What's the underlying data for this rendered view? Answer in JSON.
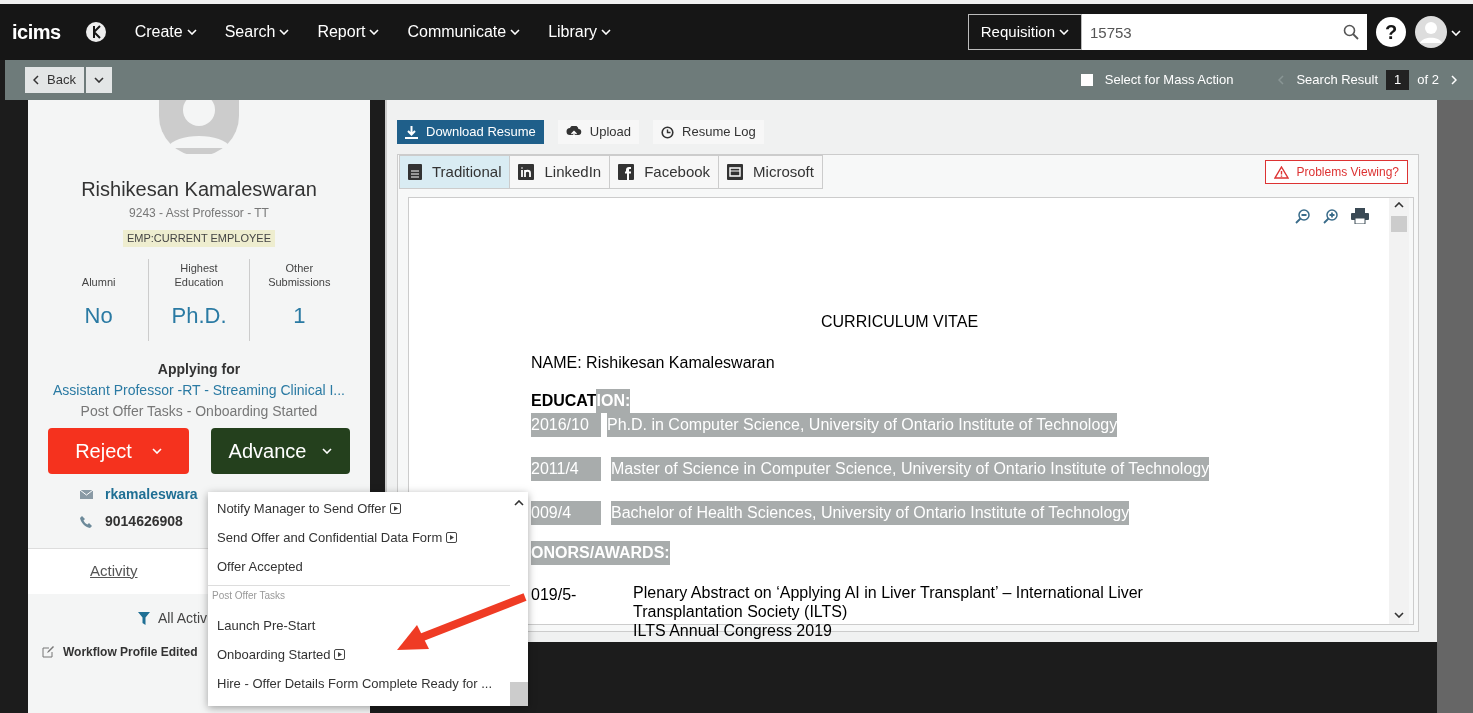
{
  "nav": {
    "logo": "icims",
    "menus": [
      "Create",
      "Search",
      "Report",
      "Communicate",
      "Library"
    ],
    "search_type": "Requisition",
    "search_value": "15753",
    "help": "?"
  },
  "toolbar": {
    "back": "Back",
    "mass_action": {
      "label": "Select for Mass Action",
      "checked": false
    },
    "search_result": {
      "label": "Search Result",
      "page": "1",
      "of": "of 2"
    }
  },
  "profile": {
    "name": "Rishikesan Kamaleswaran",
    "subtitle": "9243 - Asst Professor - TT",
    "badge": "EMP:CURRENT EMPLOYEE",
    "stats": [
      {
        "label": "Alumni",
        "value": "No"
      },
      {
        "label": "Highest Education",
        "value": "Ph.D."
      },
      {
        "label": "Other Submissions",
        "value": "1"
      }
    ],
    "applying_label": "Applying for",
    "job": "Assistant Professor -RT - Streaming Clinical I...",
    "status": "Post Offer Tasks - Onboarding Started",
    "reject": "Reject",
    "advance": "Advance",
    "email": "rkamaleswara",
    "phone": "9014626908",
    "tab": "Activity",
    "filter": "All Activ",
    "activity": "Workflow Profile Edited"
  },
  "resume": {
    "actions": [
      {
        "label": "Download Resume",
        "kind": "primary"
      },
      {
        "label": "Upload",
        "kind": "upload"
      },
      {
        "label": "Resume Log",
        "kind": "log"
      }
    ],
    "tabs": [
      {
        "label": "Traditional",
        "selected": true,
        "kind": "doc"
      },
      {
        "label": "LinkedIn",
        "selected": false,
        "kind": "linkedin"
      },
      {
        "label": "Facebook",
        "selected": false,
        "kind": "facebook"
      },
      {
        "label": "Microsoft",
        "selected": false,
        "kind": "microsoft"
      }
    ],
    "problems": "Problems Viewing?",
    "document": {
      "title": "CURRICULUM VITAE",
      "name_line": "NAME: Rishikesan Kamaleswaran",
      "education_heading": [
        {
          "text": "EDUCAT",
          "highlighted": false
        },
        {
          "text": "ION:",
          "highlighted": true
        }
      ],
      "education": [
        {
          "date": "2016/10",
          "text": "Ph.D. in Computer Science, University of Ontario Institute of Technology",
          "highlighted": true
        },
        {
          "date": "2011/4",
          "text": "Master of Science in Computer Science, University of Ontario Institute of Technology",
          "highlighted": true
        },
        {
          "date": "009/4",
          "text": "Bachelor of Health Sciences, University of Ontario Institute of Technology",
          "highlighted": true
        }
      ],
      "honors_heading": {
        "text": "ONORS/AWARDS:",
        "highlighted": true
      },
      "honors": [
        {
          "date": "019/5-",
          "lines": [
            "Plenary Abstract on ‘Applying AI in Liver Transplant’ – International Liver",
            "Transplantation Society (ILTS)",
            "ILTS Annual Congress 2019"
          ]
        }
      ]
    }
  },
  "dropdown": [
    {
      "kind": "item",
      "label": "Notify Manager to Send Offer",
      "arrow": true
    },
    {
      "kind": "item",
      "label": "Send Offer and Confidential Data Form",
      "arrow": true
    },
    {
      "kind": "item",
      "label": "Offer Accepted",
      "arrow": false
    },
    {
      "kind": "header",
      "label": "Post Offer Tasks"
    },
    {
      "kind": "item",
      "label": "Launch Pre-Start",
      "arrow": false
    },
    {
      "kind": "item",
      "label": "Onboarding Started",
      "arrow": true
    },
    {
      "kind": "item",
      "label": "Hire - Offer Details Form Complete Ready for ...",
      "arrow": false
    }
  ]
}
